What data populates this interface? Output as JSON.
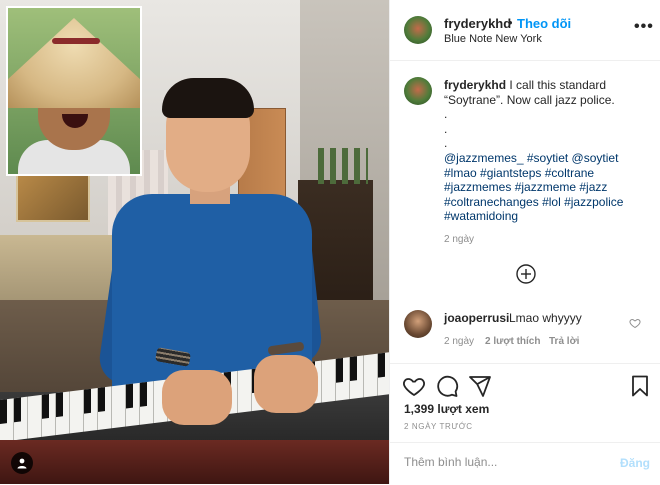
{
  "post": {
    "username": "fryderykhd",
    "follow_separator": "•",
    "follow_label": "Theo dõi",
    "location": "Blue Note New York",
    "more_label": "•••",
    "media_icon": "user-account-icon"
  },
  "caption": {
    "username": "fryderykhd",
    "text": "I call this standard “Soytrane”. Now call jazz police.",
    "dots": [
      ".",
      ".",
      "."
    ],
    "hashtags": "@jazzmemes_ #soytiet @soytiet #lmao #giantsteps #coltrane #jazzmemes #jazzmeme #jazz #coltranechanges #lol #jazzpolice #watamidoing",
    "time": "2 ngày"
  },
  "load_more_icon": "plus-circle-icon",
  "comments": [
    {
      "username": "joaoperrusi",
      "text": "Lmao whyyyy",
      "time": "2 ngày",
      "likes": "2 lượt thích",
      "reply": "Trả lời"
    }
  ],
  "actions": {
    "icons": [
      "heart-icon",
      "comment-icon",
      "share-icon",
      "bookmark-icon"
    ],
    "views": "1,399 lượt xem",
    "date": "2 NGÀY TRƯỚC"
  },
  "comment_form": {
    "placeholder": "Thêm bình luận...",
    "post_label": "Đăng",
    "post_color": "#b2dffc"
  },
  "colors": {
    "accent": "#0095f6",
    "hashtag": "#00376b",
    "muted": "#8e8e8e"
  }
}
